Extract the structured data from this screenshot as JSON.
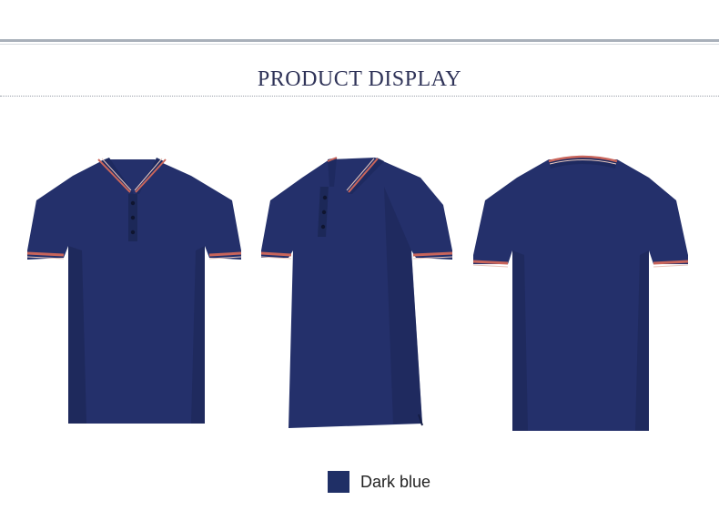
{
  "section": {
    "title": "PRODUCT DISPLAY"
  },
  "colors": {
    "shirt_body": "#24306b",
    "shirt_shadow": "#1a2452",
    "stripe_red": "#c9655b",
    "stripe_light": "#e8c8bf",
    "swatch": "#1f2f66"
  },
  "views": [
    {
      "id": "front"
    },
    {
      "id": "side"
    },
    {
      "id": "back"
    }
  ],
  "color_option": {
    "label": "Dark blue"
  }
}
